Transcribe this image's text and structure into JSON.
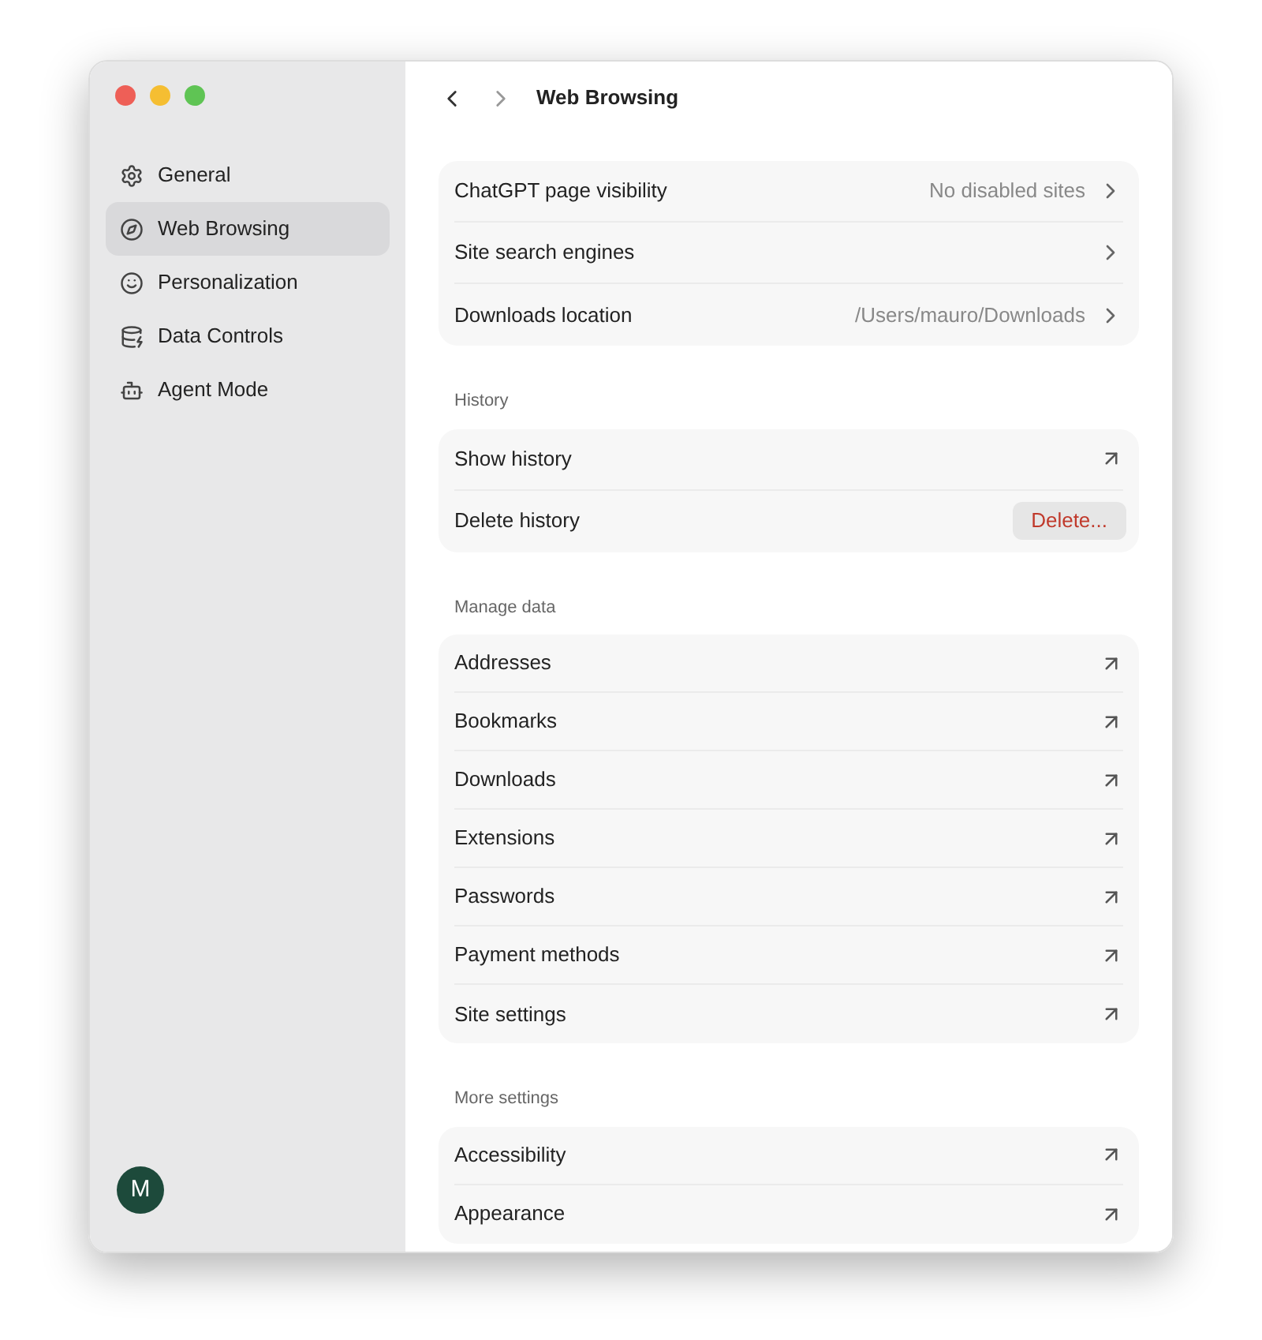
{
  "window": {
    "title": "Web Browsing"
  },
  "sidebar": {
    "items": [
      {
        "label": "General",
        "selected": false
      },
      {
        "label": "Web Browsing",
        "selected": true
      },
      {
        "label": "Personalization",
        "selected": false
      },
      {
        "label": "Data Controls",
        "selected": false
      },
      {
        "label": "Agent Mode",
        "selected": false
      }
    ],
    "avatar": "M"
  },
  "sections": [
    {
      "rows": [
        {
          "label": "ChatGPT page visibility",
          "kind": "chevron",
          "value": "No disabled sites"
        },
        {
          "label": "Site search engines",
          "kind": "chevron"
        },
        {
          "label": "Downloads location",
          "kind": "chevron",
          "value": "/Users/mauro/Downloads"
        }
      ]
    },
    {
      "title": "History",
      "rows": [
        {
          "label": "Show history",
          "kind": "external"
        },
        {
          "label": "Delete history",
          "kind": "button",
          "button": "Delete..."
        }
      ]
    },
    {
      "title": "Manage data",
      "rows": [
        {
          "label": "Addresses",
          "kind": "external"
        },
        {
          "label": "Bookmarks",
          "kind": "external"
        },
        {
          "label": "Downloads",
          "kind": "external"
        },
        {
          "label": "Extensions",
          "kind": "external"
        },
        {
          "label": "Passwords",
          "kind": "external"
        },
        {
          "label": "Payment methods",
          "kind": "external"
        },
        {
          "label": "Site settings",
          "kind": "external"
        }
      ]
    },
    {
      "title": "More settings",
      "rows": [
        {
          "label": "Accessibility",
          "kind": "external"
        },
        {
          "label": "Appearance",
          "kind": "external"
        }
      ]
    }
  ]
}
